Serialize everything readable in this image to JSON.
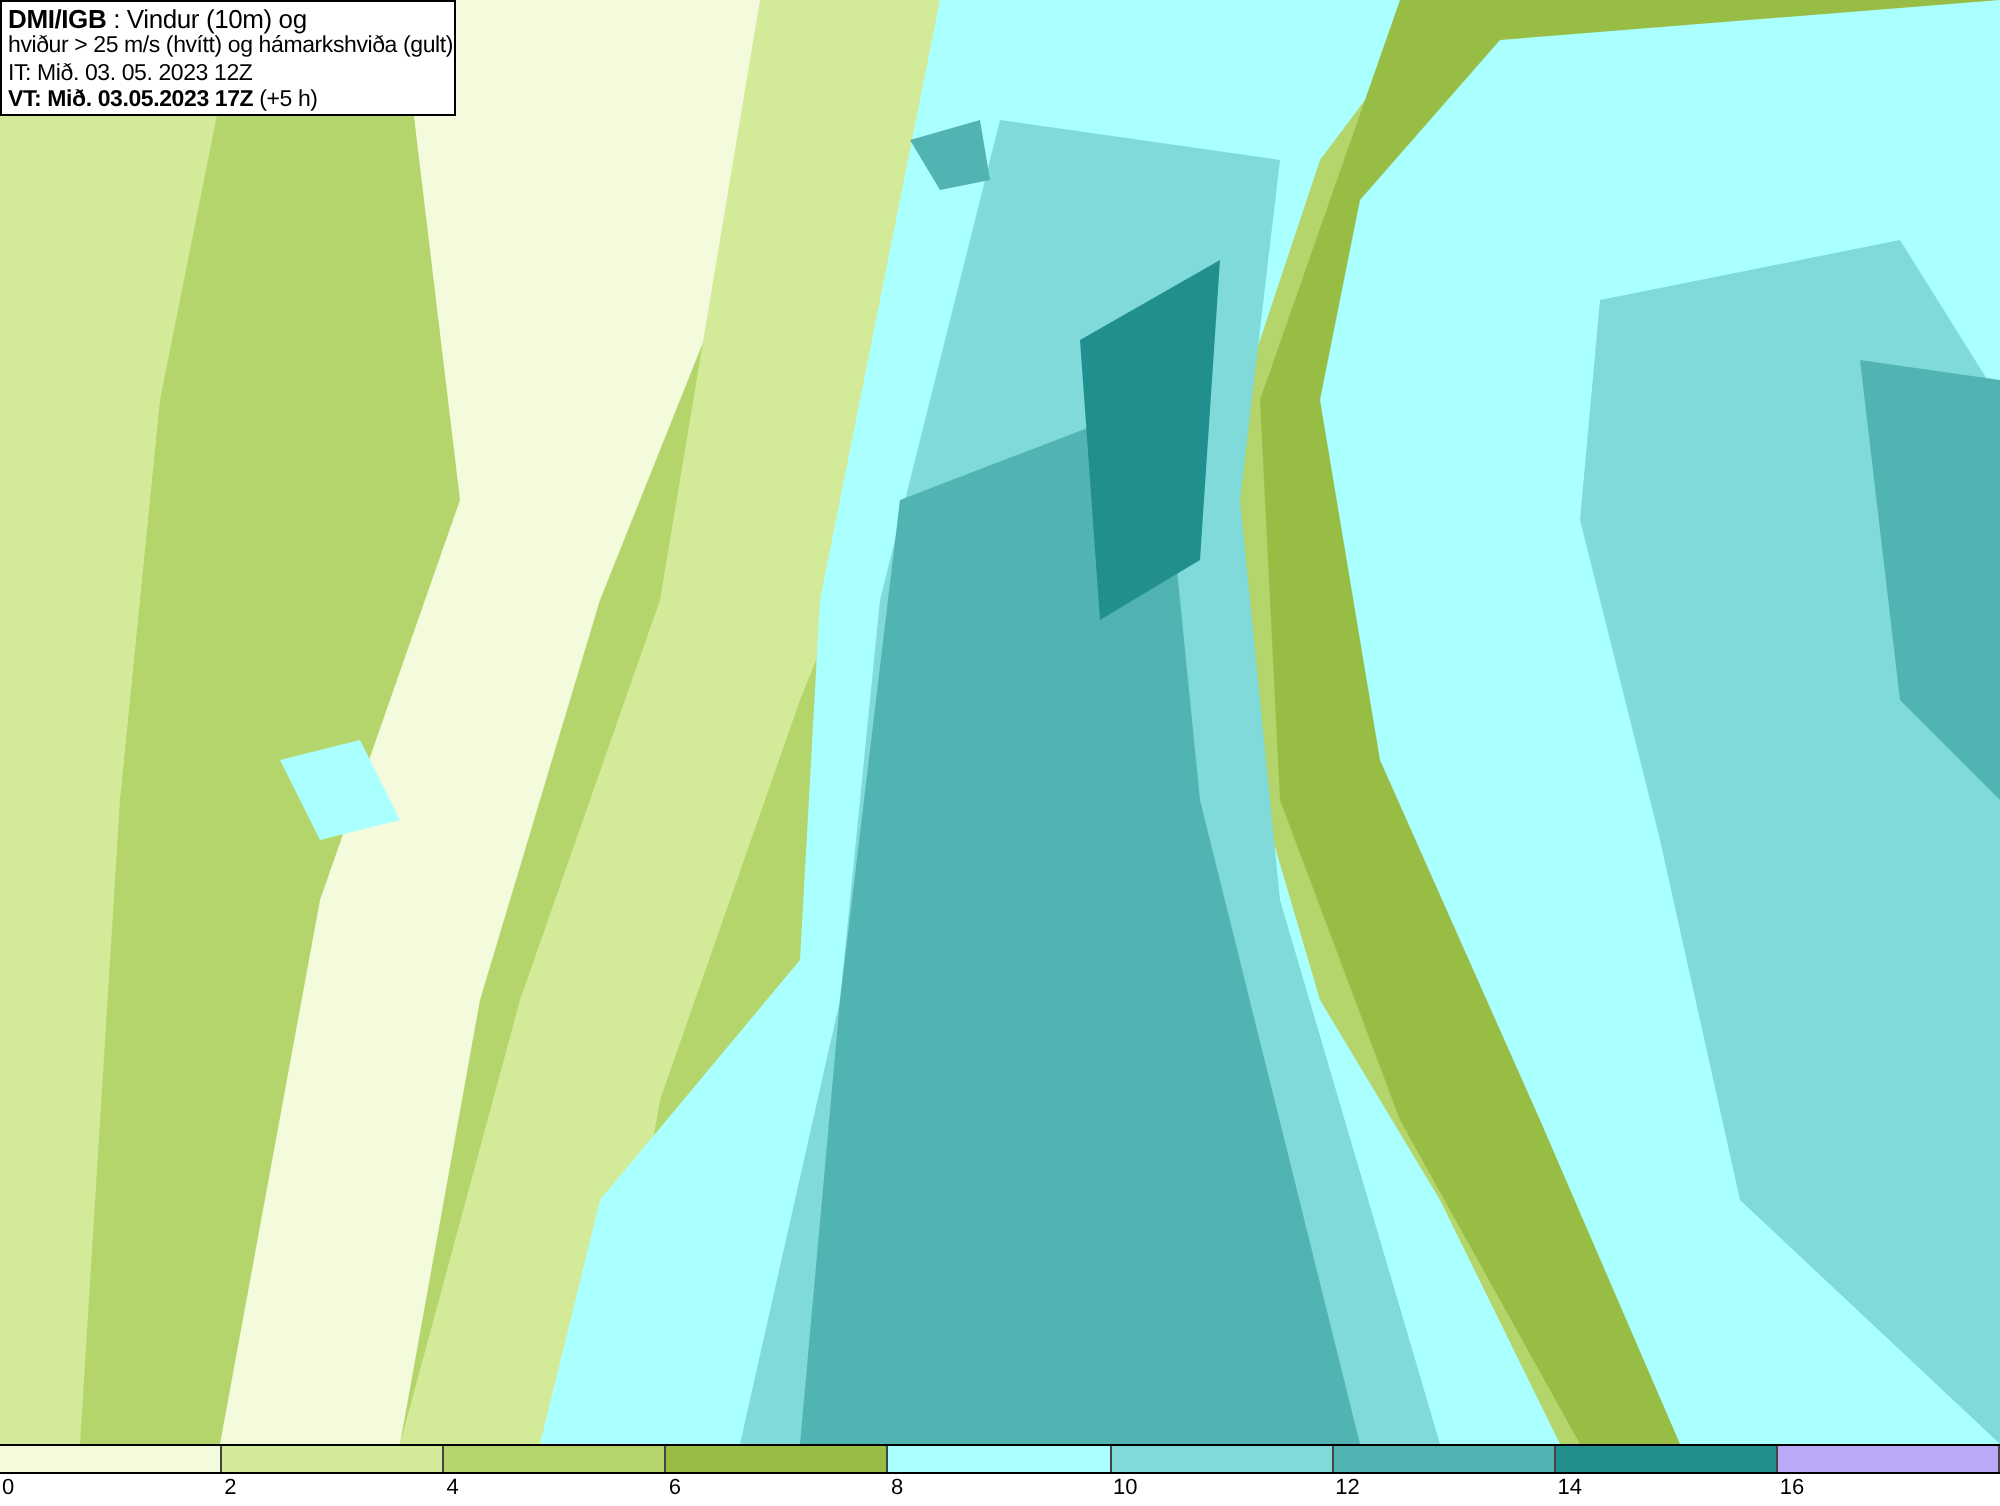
{
  "caption": [
    "**DMI/IGB** : Vindur (10m) og",
    "hviður > 25 m/s (hvítt) og hámarkshviða (gult)",
    "IT: Mið. 03. 05. 2023 12Z",
    "**VT: Mið. 03.05.2023 17Z** (+5 h)"
  ],
  "legend": {
    "swatches": [
      {
        "color": "#f4fadc"
      },
      {
        "color": "#d3eb99"
      },
      {
        "color": "#b4d46c"
      },
      {
        "color": "#97bd45"
      },
      {
        "color": "#aaffff"
      },
      {
        "color": "#80dada"
      },
      {
        "color": "#52b3b3"
      },
      {
        "color": "#228f8f"
      },
      {
        "color": "#bba8f8"
      }
    ],
    "ticks": [
      "0",
      "2",
      "4",
      "6",
      "8",
      "10",
      "12",
      "14",
      "16"
    ]
  }
}
